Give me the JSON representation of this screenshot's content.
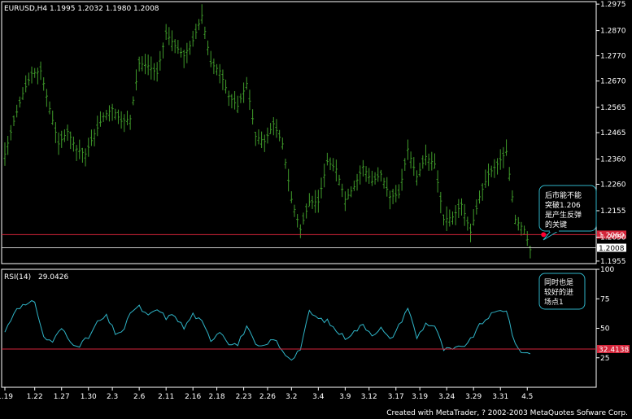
{
  "colors": {
    "background": "#000000",
    "bull": "#3f9a2a",
    "bear": "#3f9a2a",
    "rsi_line": "#2fb5c8",
    "level_line": "#d4253a",
    "axis": "#ffffff",
    "price_tag": "#ffffff",
    "callout_border": "#2fb5c8",
    "marker": "#ff0033"
  },
  "header": {
    "symbol_line": "EURUSD,H4  1.1995 1.2032 1.1980 1.2008"
  },
  "footer": {
    "credit": "Created with MetaTrader, ? 2002-2003 MetaQuotes Sofware Corp."
  },
  "annotations": {
    "price_note": [
      "后市能不能",
      "突破1.206",
      "是产生反弹",
      "的关键"
    ],
    "rsi_note": [
      "同时也是",
      "较好的进",
      "场点1"
    ]
  },
  "chart_data": [
    {
      "type": "ohlc",
      "panel": "price",
      "title": "EURUSD,H4",
      "ohlc_header": [
        1.1995,
        1.2032,
        1.198,
        1.2008
      ],
      "ylim": [
        1.1945,
        1.2985
      ],
      "y_ticks": [
        1.2975,
        1.287,
        1.277,
        1.267,
        1.2565,
        1.2465,
        1.236,
        1.226,
        1.2155,
        1.205,
        1.1955
      ],
      "y_tick_labels": [
        "1.2975",
        "1.2870",
        "1.2770",
        "1.2670",
        "1.2565",
        "1.2465",
        "1.2360",
        "1.2260",
        "1.2155",
        "1.2050",
        "1.1955"
      ],
      "horizontal_levels": [
        {
          "value": 1.206,
          "label": "1.2060",
          "kind": "resistance"
        },
        {
          "value": 1.2008,
          "label": "1.2008",
          "kind": "last_price"
        }
      ],
      "marker": {
        "bar_index": 175,
        "value": 1.206
      },
      "x_tick_labels": [
        "1.19",
        "1.22",
        "1.27",
        "1.30",
        "2.3",
        "2.6",
        "2.11",
        "2.16",
        "2.18",
        "2.23",
        "2.26",
        "3.2",
        "3.4",
        "3.9",
        "3.12",
        "3.17",
        "3.19",
        "3.24",
        "3.29",
        "3.31",
        "4.5"
      ],
      "x_tick_bar_index": [
        0,
        10,
        19,
        28,
        36,
        45,
        54,
        63,
        71,
        80,
        88,
        96,
        105,
        114,
        122,
        131,
        139,
        148,
        157,
        166,
        175
      ],
      "anchors": [
        [
          0,
          1.238
        ],
        [
          3,
          1.251
        ],
        [
          6,
          1.262
        ],
        [
          9,
          1.27
        ],
        [
          12,
          1.271
        ],
        [
          15,
          1.256
        ],
        [
          18,
          1.242
        ],
        [
          21,
          1.247
        ],
        [
          24,
          1.24
        ],
        [
          27,
          1.238
        ],
        [
          30,
          1.246
        ],
        [
          33,
          1.253
        ],
        [
          36,
          1.256
        ],
        [
          39,
          1.251
        ],
        [
          42,
          1.252
        ],
        [
          45,
          1.274
        ],
        [
          48,
          1.273
        ],
        [
          51,
          1.27
        ],
        [
          54,
          1.286
        ],
        [
          57,
          1.281
        ],
        [
          60,
          1.277
        ],
        [
          63,
          1.283
        ],
        [
          66,
          1.293
        ],
        [
          69,
          1.274
        ],
        [
          72,
          1.271
        ],
        [
          75,
          1.261
        ],
        [
          78,
          1.257
        ],
        [
          81,
          1.266
        ],
        [
          84,
          1.245
        ],
        [
          87,
          1.243
        ],
        [
          90,
          1.25
        ],
        [
          93,
          1.242
        ],
        [
          96,
          1.22
        ],
        [
          99,
          1.208
        ],
        [
          102,
          1.219
        ],
        [
          105,
          1.219
        ],
        [
          108,
          1.235
        ],
        [
          111,
          1.232
        ],
        [
          114,
          1.22
        ],
        [
          117,
          1.225
        ],
        [
          120,
          1.233
        ],
        [
          123,
          1.227
        ],
        [
          126,
          1.23
        ],
        [
          129,
          1.221
        ],
        [
          132,
          1.222
        ],
        [
          135,
          1.24
        ],
        [
          138,
          1.229
        ],
        [
          141,
          1.237
        ],
        [
          144,
          1.234
        ],
        [
          147,
          1.212
        ],
        [
          150,
          1.213
        ],
        [
          153,
          1.218
        ],
        [
          156,
          1.207
        ],
        [
          159,
          1.221
        ],
        [
          162,
          1.23
        ],
        [
          165,
          1.234
        ],
        [
          168,
          1.239
        ],
        [
          171,
          1.212
        ],
        [
          174,
          1.208
        ],
        [
          176,
          1.2
        ]
      ]
    },
    {
      "type": "line",
      "panel": "indicator",
      "title": "RSI(14)",
      "current_value": 29.0426,
      "ylim": [
        0,
        100
      ],
      "y_ticks": [
        100,
        75,
        50,
        25
      ],
      "y_tick_labels": [
        "100",
        "75",
        "50",
        "25"
      ],
      "horizontal_levels": [
        {
          "value": 32.4138,
          "label": "32.4138"
        }
      ],
      "anchors": [
        [
          0,
          47
        ],
        [
          4,
          68
        ],
        [
          8,
          70
        ],
        [
          10,
          73
        ],
        [
          13,
          42
        ],
        [
          16,
          39
        ],
        [
          19,
          50
        ],
        [
          22,
          38
        ],
        [
          25,
          36
        ],
        [
          28,
          42
        ],
        [
          31,
          55
        ],
        [
          34,
          60
        ],
        [
          37,
          46
        ],
        [
          40,
          48
        ],
        [
          42,
          64
        ],
        [
          45,
          68
        ],
        [
          48,
          60
        ],
        [
          51,
          66
        ],
        [
          54,
          59
        ],
        [
          57,
          61
        ],
        [
          60,
          50
        ],
        [
          63,
          62
        ],
        [
          66,
          55
        ],
        [
          69,
          40
        ],
        [
          72,
          48
        ],
        [
          75,
          38
        ],
        [
          78,
          36
        ],
        [
          81,
          52
        ],
        [
          84,
          35
        ],
        [
          87,
          34
        ],
        [
          90,
          42
        ],
        [
          93,
          30
        ],
        [
          96,
          24
        ],
        [
          99,
          33
        ],
        [
          102,
          64
        ],
        [
          105,
          58
        ],
        [
          108,
          56
        ],
        [
          111,
          48
        ],
        [
          114,
          42
        ],
        [
          117,
          47
        ],
        [
          120,
          53
        ],
        [
          123,
          45
        ],
        [
          126,
          50
        ],
        [
          129,
          40
        ],
        [
          132,
          52
        ],
        [
          135,
          68
        ],
        [
          138,
          42
        ],
        [
          141,
          54
        ],
        [
          144,
          52
        ],
        [
          147,
          32
        ],
        [
          150,
          32
        ],
        [
          153,
          34
        ],
        [
          156,
          40
        ],
        [
          159,
          52
        ],
        [
          162,
          60
        ],
        [
          165,
          64
        ],
        [
          168,
          66
        ],
        [
          171,
          35
        ],
        [
          174,
          29
        ],
        [
          176,
          29
        ]
      ]
    }
  ]
}
